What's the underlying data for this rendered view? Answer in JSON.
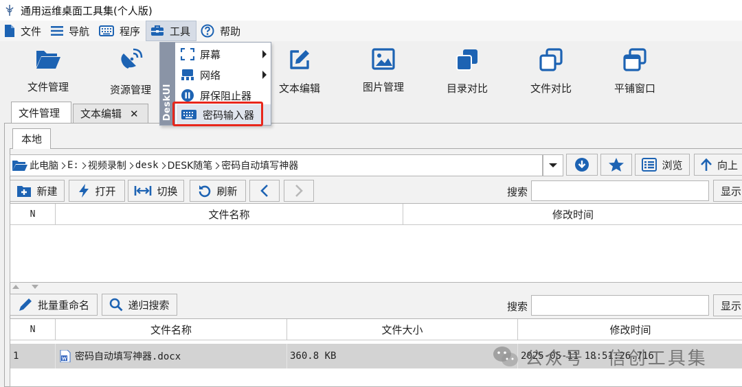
{
  "window": {
    "title": "通用运维桌面工具集(个人版)"
  },
  "menubar": {
    "items": [
      {
        "label": "文件",
        "icon": "document-icon"
      },
      {
        "label": "导航",
        "icon": "hamburger-icon"
      },
      {
        "label": "程序",
        "icon": "keyboard-icon"
      },
      {
        "label": "工具",
        "icon": "toolbox-icon",
        "active": true
      },
      {
        "label": "帮助",
        "icon": "help-circle-icon"
      }
    ]
  },
  "toolbar": {
    "items": [
      {
        "label": "文件管理",
        "icon": "folder-open-icon"
      },
      {
        "label": "资源管理",
        "icon": "satellite-dish-icon"
      },
      {
        "label": "文本编辑",
        "icon": "edit-square-icon"
      },
      {
        "label": "图片管理",
        "icon": "image-icon"
      },
      {
        "label": "目录对比",
        "icon": "stacked-squares-icon"
      },
      {
        "label": "文件对比",
        "icon": "copy-squares-icon"
      },
      {
        "label": "平铺窗口",
        "icon": "windows-icon"
      }
    ]
  },
  "tools_menu": {
    "brand": "DeskUI",
    "items": [
      {
        "label": "屏幕",
        "icon": "screen-frame-icon",
        "submenu": true
      },
      {
        "label": "网络",
        "icon": "network-icon",
        "submenu": true
      },
      {
        "label": "屏保阻止器",
        "icon": "pause-circle-icon",
        "submenu": false
      },
      {
        "label": "密码输入器",
        "icon": "keyboard-icon",
        "submenu": false,
        "selected": true
      }
    ]
  },
  "tabs": [
    {
      "label": "文件管理",
      "active": true
    },
    {
      "label": "文本编辑",
      "closable": true,
      "close_glyph": "✕"
    }
  ],
  "subtabs": [
    {
      "label": "本地"
    }
  ],
  "path": {
    "crumbs": [
      "此电脑",
      "E:",
      "视频录制",
      "desk",
      "DESK随笔",
      "密码自动填写神器"
    ]
  },
  "nav_buttons": {
    "browse": "浏览",
    "up": "向上"
  },
  "actions_top": {
    "new": "新建",
    "open": "打开",
    "switch": "切换",
    "refresh": "刷新"
  },
  "search_top": {
    "label": "搜索",
    "show_btn": "显示"
  },
  "table_top": {
    "headers": {
      "n": "N",
      "name": "文件名称",
      "mtime": "修改时间"
    },
    "rows": []
  },
  "actions_bottom": {
    "batch_rename": "批量重命名",
    "recursive_search": "递归搜索"
  },
  "search_bottom": {
    "label": "搜索",
    "show_btn": "显示"
  },
  "table_bottom": {
    "headers": {
      "n": "N",
      "name": "文件名称",
      "size": "文件大小",
      "mtime": "修改时间"
    },
    "rows": [
      {
        "n": "1",
        "name": "密码自动填写神器.docx",
        "size": "360.8 KB",
        "mtime": "2025-05-11 18:51:26.716"
      }
    ]
  },
  "watermark": {
    "text": "公众号 · 信创工具集"
  },
  "colors": {
    "accent": "#1d63b3",
    "highlight": "#e8261b",
    "menu_strip": "#8a94a6"
  }
}
